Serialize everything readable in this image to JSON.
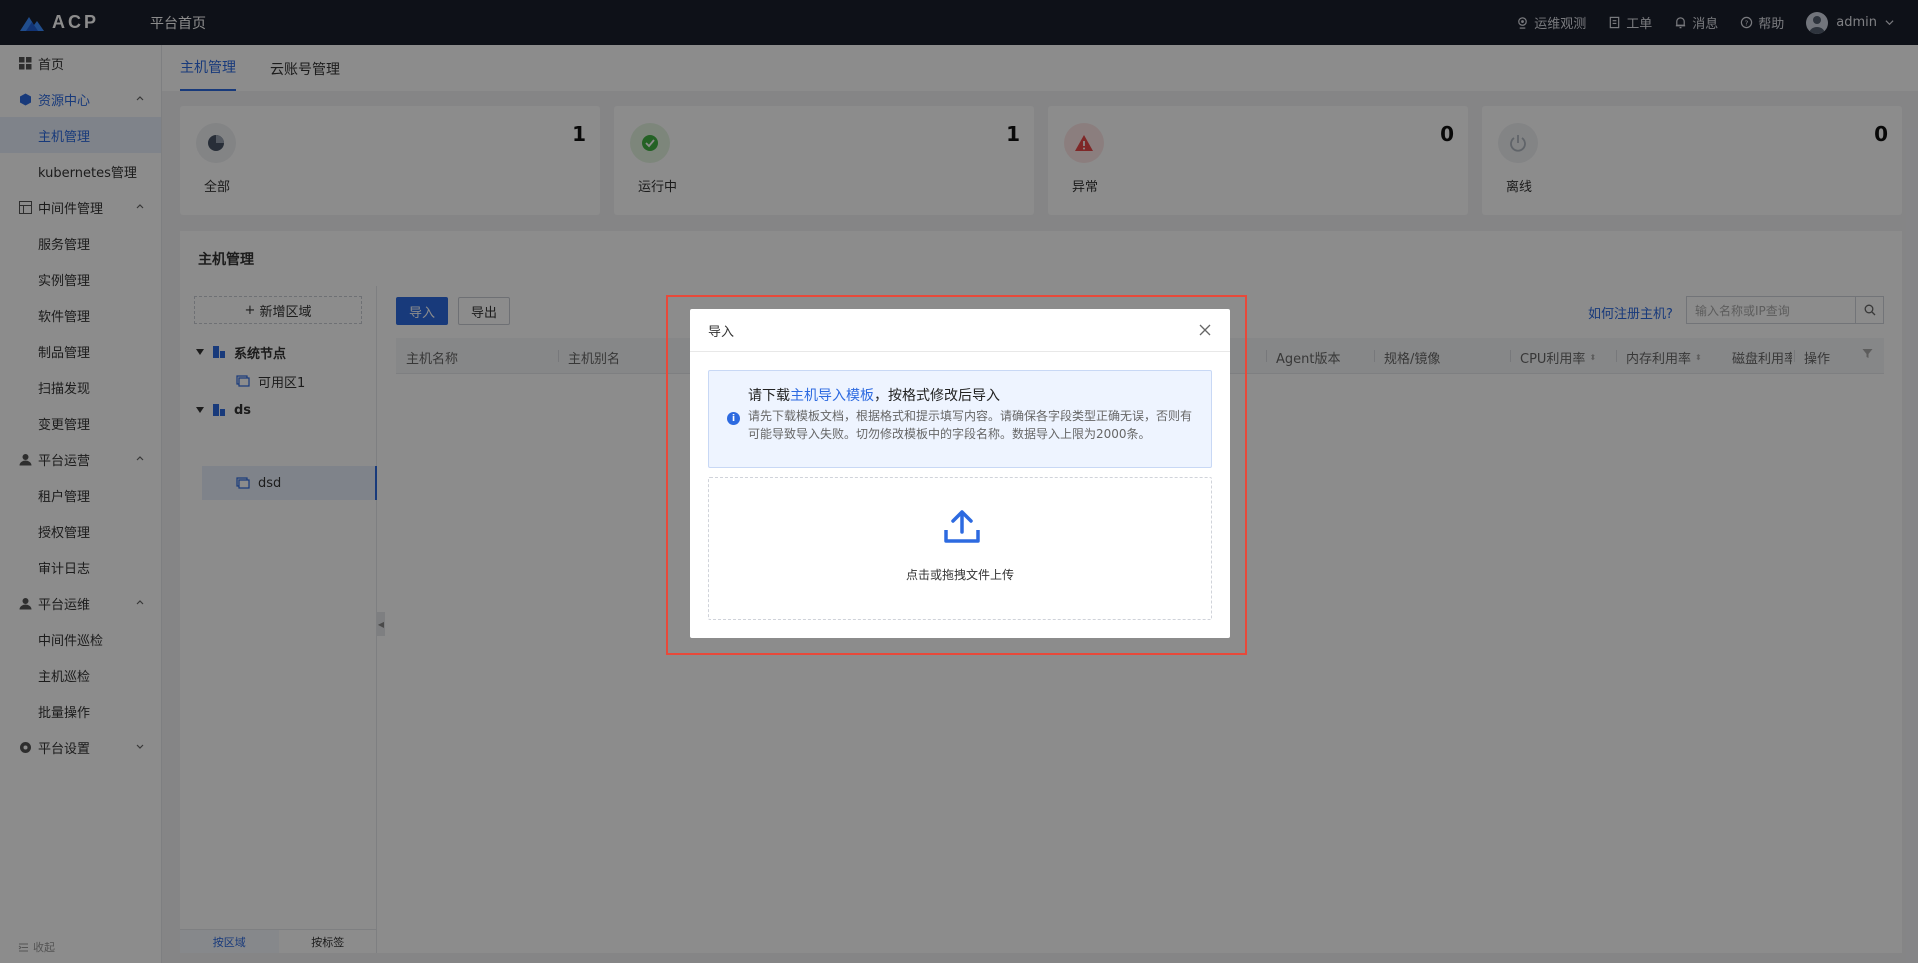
{
  "topbar": {
    "logo_text": "ACP",
    "home_title": "平台首页",
    "items": [
      "运维观测",
      "工单",
      "消息",
      "帮助"
    ],
    "username": "admin"
  },
  "sidebar": {
    "items": [
      {
        "label": "首页",
        "level": 0
      },
      {
        "label": "资源中心",
        "level": 0
      },
      {
        "label": "主机管理",
        "level": 1
      },
      {
        "label": "kubernetes管理",
        "level": 1
      },
      {
        "label": "中间件管理",
        "level": 0
      },
      {
        "label": "服务管理",
        "level": 1
      },
      {
        "label": "实例管理",
        "level": 1
      },
      {
        "label": "软件管理",
        "level": 1
      },
      {
        "label": "制品管理",
        "level": 1
      },
      {
        "label": "扫描发现",
        "level": 1
      },
      {
        "label": "变更管理",
        "level": 1
      },
      {
        "label": "平台运营",
        "level": 0
      },
      {
        "label": "租户管理",
        "level": 1
      },
      {
        "label": "授权管理",
        "level": 1
      },
      {
        "label": "审计日志",
        "level": 1
      },
      {
        "label": "平台运维",
        "level": 0
      },
      {
        "label": "中间件巡检",
        "level": 1
      },
      {
        "label": "主机巡检",
        "level": 1
      },
      {
        "label": "批量操作",
        "level": 1
      },
      {
        "label": "平台设置",
        "level": 0
      }
    ],
    "collapse_label": "收起"
  },
  "tabs": [
    "主机管理",
    "云账号管理"
  ],
  "cards": [
    {
      "label": "全部",
      "count": "1"
    },
    {
      "label": "运行中",
      "count": "1"
    },
    {
      "label": "异常",
      "count": "0"
    },
    {
      "label": "离线",
      "count": "0"
    }
  ],
  "panel": {
    "title": "主机管理",
    "add_region": "新增区域",
    "tree": [
      {
        "label": "系统节点",
        "children": [
          "可用区1"
        ]
      },
      {
        "label": "ds",
        "children": [
          "dsd"
        ]
      }
    ],
    "tree_footer": [
      "按区域",
      "按标签"
    ],
    "import_btn": "导入",
    "export_btn": "导出",
    "how_link": "如何注册主机?",
    "search_placeholder": "输入名称或IP查询",
    "columns": [
      "主机名称",
      "主机别名",
      "Agent版本",
      "规格/镜像",
      "CPU利用率",
      "内存利用率",
      "磁盘利用率",
      "操作"
    ]
  },
  "modal": {
    "title": "导入",
    "notice_prefix": "请下载",
    "notice_link": "主机导入模板",
    "notice_suffix": "，按格式修改后导入",
    "notice_desc": "请先下载模板文档，根据格式和提示填写内容。请确保各字段类型正确无误，否则有可能导致导入失败。切勿修改模板中的字段名称。数据导入上限为2000条。",
    "upload_text": "点击或拖拽文件上传"
  },
  "colors": {
    "primary": "#2d6ae0",
    "highlight": "#e8493a"
  }
}
